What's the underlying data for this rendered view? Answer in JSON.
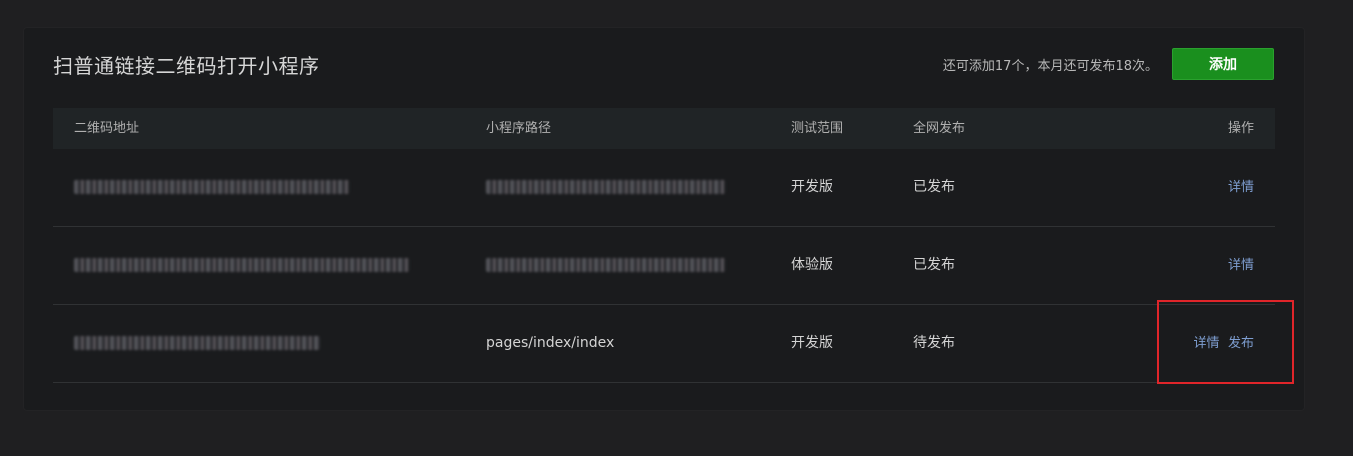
{
  "page": {
    "title": "扫普通链接二维码打开小程序",
    "quota_text": "还可添加17个，本月还可发布18次。",
    "add_button_label": "添加"
  },
  "table": {
    "headers": {
      "qr_address": "二维码地址",
      "miniprogram_path": "小程序路径",
      "test_scope": "测试范围",
      "publish_status": "全网发布",
      "actions": "操作"
    },
    "rows": [
      {
        "qr_address": "",
        "miniprogram_path": "",
        "test_scope": "开发版",
        "publish_status": "已发布",
        "action_detail": "详情",
        "action_publish": ""
      },
      {
        "qr_address": "",
        "miniprogram_path": "",
        "test_scope": "体验版",
        "publish_status": "已发布",
        "action_detail": "详情",
        "action_publish": ""
      },
      {
        "qr_address": "",
        "miniprogram_path": "pages/index/index",
        "test_scope": "开发版",
        "publish_status": "待发布",
        "action_detail": "详情",
        "action_publish": "发布"
      }
    ]
  },
  "colors": {
    "background": "#1f1f21",
    "panel": "#1a1b1d",
    "header_row": "#202426",
    "primary_button": "#1a8f1e",
    "link": "#7e9ed1",
    "highlight_annotation": "#e0252a"
  }
}
